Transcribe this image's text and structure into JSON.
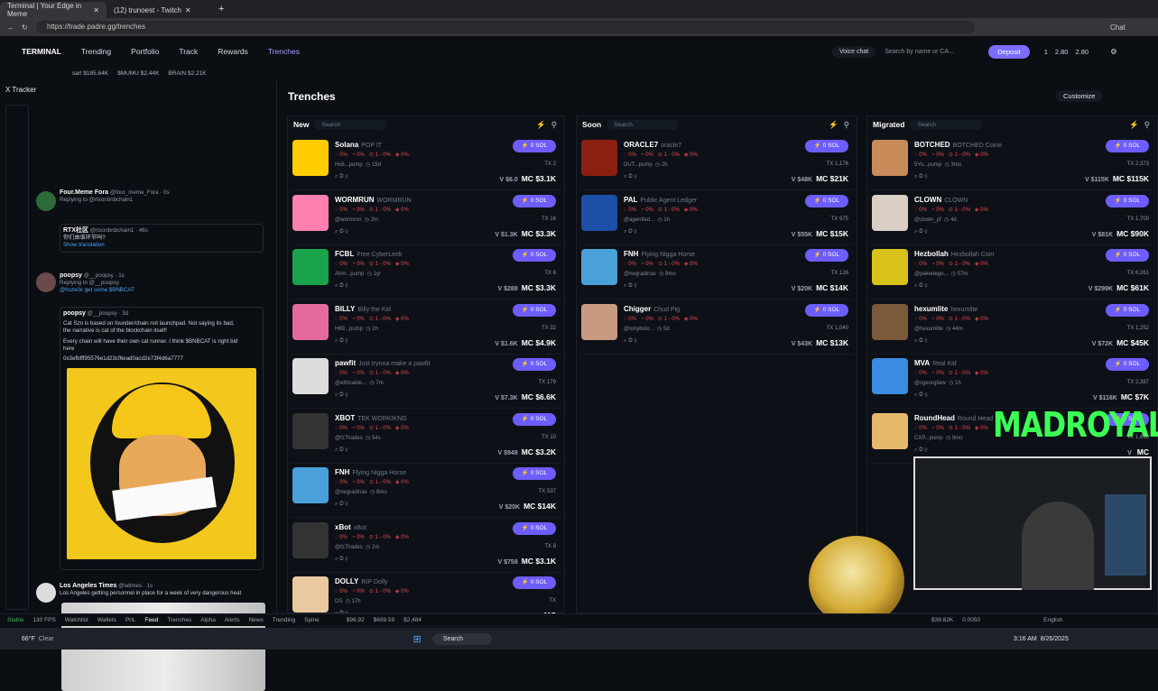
{
  "browser": {
    "tab1": "Terminal | Your Edge in Meme",
    "tab2": "(12) trunoest - Twitch",
    "url": "https://trade.padre.gg/trenches",
    "chat": "Chat"
  },
  "nav": {
    "brand": "TERMINAL",
    "links": [
      "Trending",
      "Portfolio",
      "Track",
      "Rewards",
      "Trenches"
    ],
    "voice": "Voice chat",
    "search": "Search by name or CA...",
    "deposit": "Deposit",
    "wallet": "1",
    "bal1": "2.80",
    "bal2": "2.80"
  },
  "ticker": {
    "items": [
      "sarl $185.64K",
      "$MUMU $2.44K",
      "BRAIN $2.21K"
    ]
  },
  "tracker": {
    "title": "X Tracker",
    "t1": {
      "name": "Four.Meme Fora",
      "handle": "@four_meme_Fora · 0s",
      "reply": "Replying to @rtxonbnbchain1",
      "qname": "RTX社区",
      "qhandle": "@rtxonbnbchain1 · 46s",
      "qtext": "你们由谁环节吗?",
      "translate": "Show translation"
    },
    "t2": {
      "name": "poopsy",
      "handle": "@__poopsy · 1s",
      "reply": "Replying to @__poopsy",
      "reply2": "@hsze0x get some $BNBCAT",
      "qname": "poopsy",
      "qhandle": "@__poopsy · 3d",
      "l1": "Cat Szn is based on founder/chain not launchpad. Not saying its bad,",
      "l2": "the narrative is cat of the blockchain itself!",
      "l3": "Every chain will have their own cat runner. I think $BNBCAT is right bid",
      "l4": "here",
      "ca": "0x3efbfff95576e1d23cf6ead0acd2e73f4d6a7777"
    },
    "t3": {
      "name": "Los Angeles Times",
      "handle": "@latimes · 1s",
      "text": "Los Angeles getting personnel in place for a week of very dangerous heat"
    }
  },
  "main": {
    "title": "Trenches",
    "customize": "Customize"
  },
  "columns": [
    {
      "title": "New",
      "search": "Search",
      "cards": [
        {
          "name": "Solana",
          "sub": "POP IT",
          "addr": "Hs6...pump",
          "age": "15d",
          "tx": "2",
          "mc": "$3.1K",
          "v": "$6.0",
          "color": "#ffcc00"
        },
        {
          "name": "WORMRUN",
          "sub": "WORMRUN",
          "addr": "@wormrun",
          "age": "2m",
          "tx": "16",
          "mc": "$3.3K",
          "v": "$1.3K",
          "color": "#ff7fb0"
        },
        {
          "name": "FCBL",
          "sub": "Free CyberLeek",
          "addr": "Ahm...pump",
          "age": "1yr",
          "tx": "8",
          "mc": "$3.3K",
          "v": "$288",
          "color": "#1aa34a"
        },
        {
          "name": "BILLY",
          "sub": "Billy the Kid",
          "addr": "H89...pump",
          "age": "2h",
          "tx": "32",
          "mc": "$4.9K",
          "v": "$1.6K",
          "color": "#e46a9d"
        },
        {
          "name": "pawfit",
          "sub": "Just trynna make a pawfit",
          "addr": "@ethicalde...",
          "age": "7m",
          "tx": "179",
          "mc": "$6.6K",
          "v": "$7.3K",
          "color": "#dddddd"
        },
        {
          "name": "XBOT",
          "sub": "TEK WORKIKNG",
          "addr": "@fz7trades",
          "age": "54s",
          "tx": "10",
          "mc": "$3.2K",
          "v": "$948",
          "color": "#333333"
        },
        {
          "name": "FNH",
          "sub": "Flying Nigga Horse",
          "addr": "@negradinas",
          "age": "8mo",
          "tx": "537",
          "mc": "$14K",
          "v": "$20K",
          "color": "#4aa0d8"
        },
        {
          "name": "xBot",
          "sub": "xBot",
          "addr": "@fz7trades",
          "age": "2m",
          "tx": "8",
          "mc": "$3.1K",
          "v": "$758",
          "color": "#333333"
        },
        {
          "name": "DOLLY",
          "sub": "RIP Dolly",
          "addr": "DS",
          "age": "17h",
          "tx": "",
          "mc": "",
          "v": "",
          "color": "#e8c9a0"
        }
      ]
    },
    {
      "title": "Soon",
      "search": "Search",
      "cards": [
        {
          "name": "ORACLE7",
          "sub": "oracle7",
          "addr": "DUT...pump",
          "age": "2h",
          "tx": "1,176",
          "mc": "$21K",
          "v": "$48K",
          "color": "#8a1f12"
        },
        {
          "name": "PAL",
          "sub": "Public Agent Ledger",
          "addr": "@agentled...",
          "age": "1h",
          "tx": "975",
          "mc": "$15K",
          "v": "$55K",
          "color": "#1b4fa8"
        },
        {
          "name": "FNH",
          "sub": "Flying Nigga Horse",
          "addr": "@negradinas",
          "age": "8mo",
          "tx": "126",
          "mc": "$14K",
          "v": "$20K",
          "color": "#4aa0d8"
        },
        {
          "name": "Chigger",
          "sub": "Chud Pig",
          "addr": "@tonybolo...",
          "age": "5d",
          "tx": "1,040",
          "mc": "$13K",
          "v": "$43K",
          "color": "#c89a80"
        }
      ]
    },
    {
      "title": "Migrated",
      "search": "Search",
      "cards": [
        {
          "name": "BOTCHED",
          "sub": "BOTCHED Coine",
          "addr": "5Yo...pump",
          "age": "3mo",
          "tx": "2,373",
          "mc": "$115K",
          "v": "$115K",
          "color": "#c98a5a"
        },
        {
          "name": "CLOWN",
          "sub": "CLOWN",
          "addr": "@clown_pf",
          "age": "4d",
          "tx": "1,700",
          "mc": "$90K",
          "v": "$81K",
          "color": "#d9cfc4"
        },
        {
          "name": "Hezbollah",
          "sub": "Hezbollah Coin",
          "addr": "@pakedego...",
          "age": "57m",
          "tx": "6,261",
          "mc": "$61K",
          "v": "$299K",
          "color": "#d8c21a"
        },
        {
          "name": "hexumlite",
          "sub": "hexumlite",
          "addr": "@hexumlite",
          "age": "44m",
          "tx": "1,252",
          "mc": "$45K",
          "v": "$72K",
          "color": "#7a5a3a"
        },
        {
          "name": "MVA",
          "sub": "Real Kid",
          "addr": "@cgeorgilaw",
          "age": "1h",
          "tx": "2,387",
          "mc": "$7K",
          "v": "$116K",
          "color": "#3b8be0"
        },
        {
          "name": "RoundHead",
          "sub": "Round Head",
          "addr": "CXP...pump",
          "age": "9mo",
          "tx": "1,630",
          "mc": "",
          "v": "",
          "color": "#e6b86a"
        }
      ]
    }
  ],
  "overlay": {
    "channel": "MADROYALS"
  },
  "bottom": {
    "status": "Stable",
    "fps": "130 FPS",
    "items": [
      "Watchlist",
      "Wallets",
      "PnL",
      "Feed",
      "Trenches",
      "Alpha",
      "Alerts",
      "News",
      "Trending",
      "Spine"
    ],
    "p1": "$96.92",
    "p2": "$699.59",
    "p3": "$2,484",
    "right1": "$39.82K",
    "right2": "0.0050",
    "lang": "English"
  },
  "taskbar": {
    "temp": "66°F",
    "weather": "Clear",
    "search": "Search",
    "time": "3:16 AM",
    "date": "8/26/2025"
  }
}
